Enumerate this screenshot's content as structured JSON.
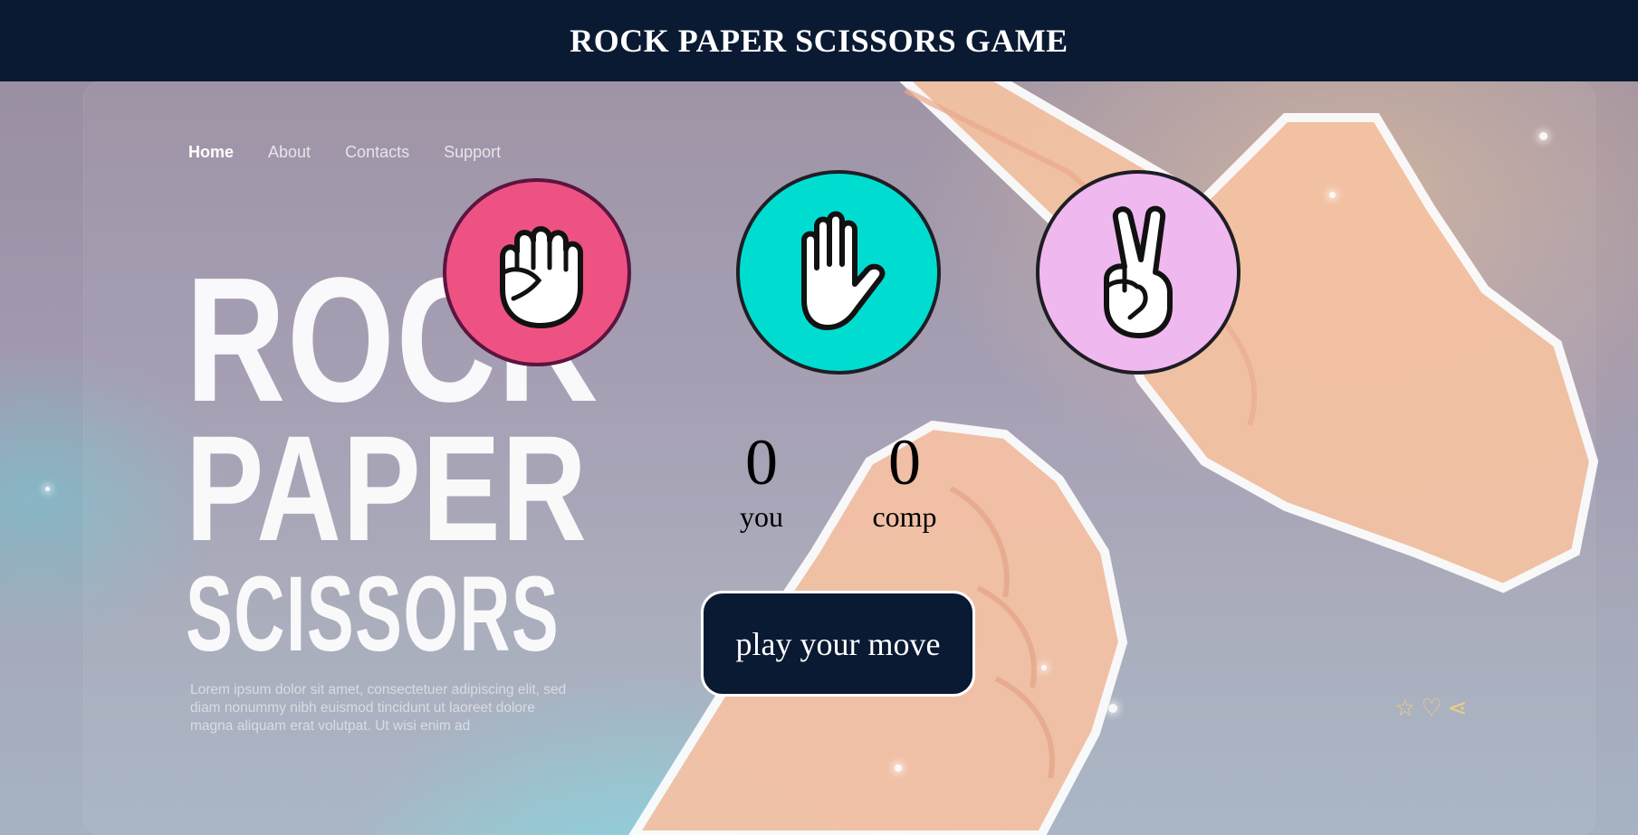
{
  "header": {
    "title": "ROCK PAPER SCISSORS GAME"
  },
  "background": {
    "nav": [
      "Home",
      "About",
      "Contacts",
      "Support"
    ],
    "headline": [
      "ROCK",
      "PAPER",
      "SCISSORS"
    ],
    "lorem": "Lorem ipsum dolor sit amet, consectetuer adipiscing elit, sed diam nonummy nibh euismod tincidunt ut laoreet dolore magna aliquam erat volutpat. Ut wisi enim ad",
    "icons": [
      "star-icon",
      "heart-icon",
      "share-icon"
    ]
  },
  "choices": [
    {
      "id": "rock",
      "icon": "fist-icon",
      "color": "#ee5283"
    },
    {
      "id": "paper",
      "icon": "open-hand-icon",
      "color": "#00ddd0"
    },
    {
      "id": "scissors",
      "icon": "victory-hand-icon",
      "color": "#efb8ef"
    }
  ],
  "scoreboard": {
    "you": {
      "score": "0",
      "label": "you"
    },
    "comp": {
      "score": "0",
      "label": "comp"
    }
  },
  "message": "play your move",
  "colors": {
    "header_bg": "#0b1a33",
    "message_bg": "#0b1a33"
  }
}
